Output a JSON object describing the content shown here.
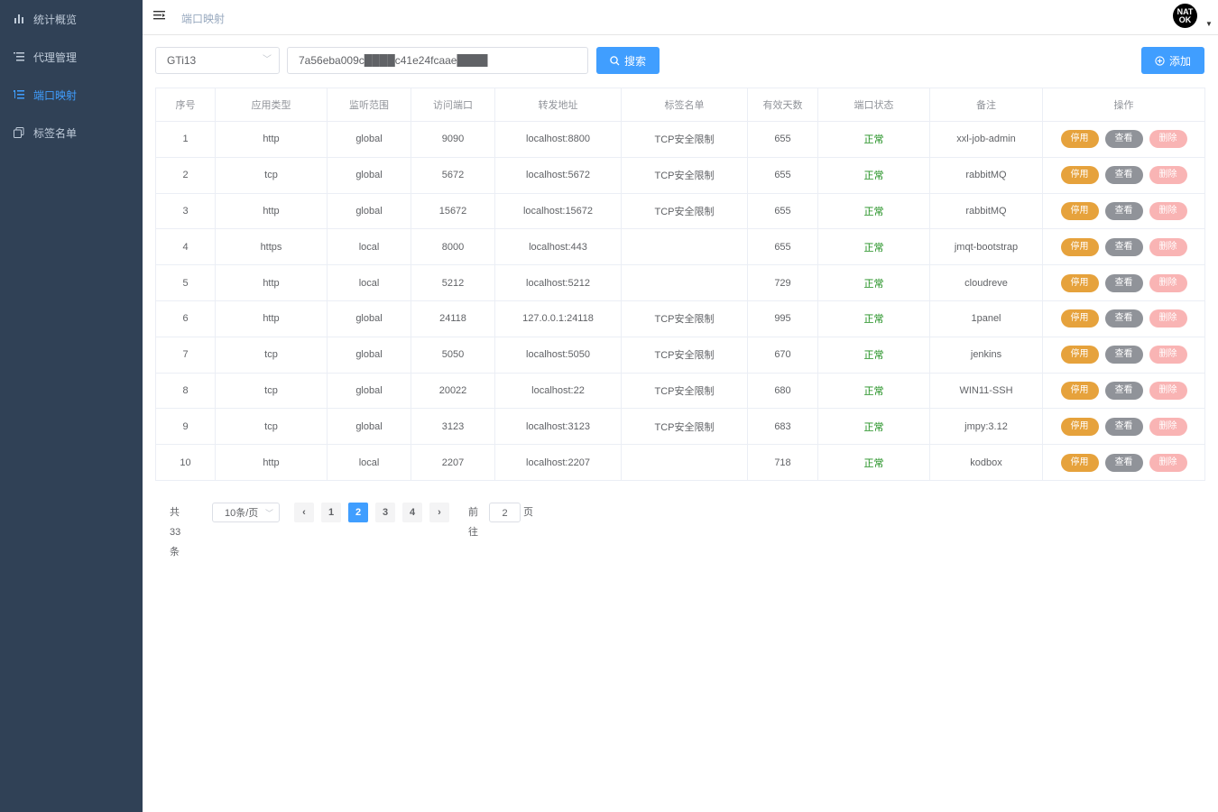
{
  "sidebar": {
    "items": [
      {
        "label": "统计概览",
        "icon": "bar-chart-icon"
      },
      {
        "label": "代理管理",
        "icon": "list-icon"
      },
      {
        "label": "端口映射",
        "icon": "tree-list-icon",
        "active": true
      },
      {
        "label": "标签名单",
        "icon": "copy-icon"
      }
    ]
  },
  "header": {
    "breadcrumb": "端口映射",
    "avatar_line1": "NAT",
    "avatar_line2": "OK"
  },
  "filters": {
    "client_select": "GTi13",
    "search_value": "7a56eba009c████c41e24fcaae████",
    "search_label": "搜索",
    "add_label": "添加"
  },
  "table": {
    "headers": [
      "序号",
      "应用类型",
      "监听范围",
      "访问端口",
      "转发地址",
      "标签名单",
      "有效天数",
      "端口状态",
      "备注",
      "操作"
    ],
    "rows": [
      [
        "1",
        "http",
        "global",
        "9090",
        "localhost:8800",
        "TCP安全限制",
        "655",
        "正常",
        "xxl-job-admin"
      ],
      [
        "2",
        "tcp",
        "global",
        "5672",
        "localhost:5672",
        "TCP安全限制",
        "655",
        "正常",
        "rabbitMQ"
      ],
      [
        "3",
        "http",
        "global",
        "15672",
        "localhost:15672",
        "TCP安全限制",
        "655",
        "正常",
        "rabbitMQ"
      ],
      [
        "4",
        "https",
        "local",
        "8000",
        "localhost:443",
        "",
        "655",
        "正常",
        "jmqt-bootstrap"
      ],
      [
        "5",
        "http",
        "local",
        "5212",
        "localhost:5212",
        "",
        "729",
        "正常",
        "cloudreve"
      ],
      [
        "6",
        "http",
        "global",
        "24118",
        "127.0.0.1:24118",
        "TCP安全限制",
        "995",
        "正常",
        "1panel"
      ],
      [
        "7",
        "tcp",
        "global",
        "5050",
        "localhost:5050",
        "TCP安全限制",
        "670",
        "正常",
        "jenkins"
      ],
      [
        "8",
        "tcp",
        "global",
        "20022",
        "localhost:22",
        "TCP安全限制",
        "680",
        "正常",
        "WIN11-SSH"
      ],
      [
        "9",
        "tcp",
        "global",
        "3123",
        "localhost:3123",
        "TCP安全限制",
        "683",
        "正常",
        "jmpy:3.12"
      ],
      [
        "10",
        "http",
        "local",
        "2207",
        "localhost:2207",
        "",
        "718",
        "正常",
        "kodbox"
      ]
    ],
    "actions": {
      "stop": "停用",
      "view": "查看",
      "delete": "删除"
    }
  },
  "pagination": {
    "total": "共 33 条",
    "page_size": "10条/页",
    "pages": [
      "1",
      "2",
      "3",
      "4"
    ],
    "current": "2",
    "goto_prefix": "前往",
    "goto_value": "2",
    "goto_suffix": "页"
  },
  "colors": {
    "sidebar_bg": "#304156",
    "primary": "#409eff",
    "warning": "#e6a23c",
    "info": "#909399",
    "danger_light": "#f9b4b4",
    "success": "#1e8e1e"
  }
}
